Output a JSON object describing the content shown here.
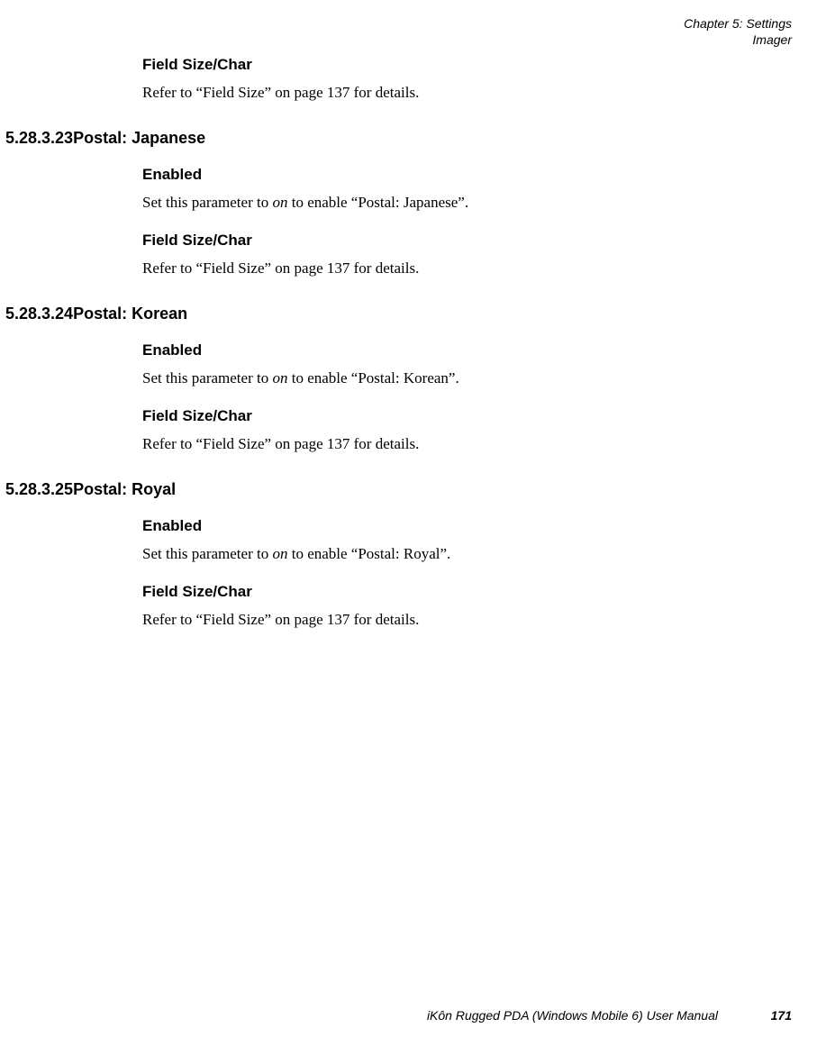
{
  "header": {
    "chapter_line": "Chapter 5:  Settings",
    "section_line": "Imager"
  },
  "block0": {
    "h1": "Field Size/Char",
    "p1a": "Refer to “Field Size” on page 137 for details."
  },
  "sec23": {
    "num": "5.28.3.23",
    "title": "Postal: Japanese",
    "h1": "Enabled",
    "p1a": "Set this parameter to ",
    "p1i": "on",
    "p1b": " to enable “Postal: Japanese”.",
    "h2": "Field Size/Char",
    "p2a": "Refer to “Field Size” on page 137 for details."
  },
  "sec24": {
    "num": "5.28.3.24",
    "title": "Postal: Korean",
    "h1": "Enabled",
    "p1a": "Set this parameter to ",
    "p1i": "on",
    "p1b": " to enable “Postal: Korean”.",
    "h2": "Field Size/Char",
    "p2a": "Refer to “Field Size” on page 137 for details."
  },
  "sec25": {
    "num": "5.28.3.25",
    "title": "Postal: Royal",
    "h1": "Enabled",
    "p1a": "Set this parameter to ",
    "p1i": "on",
    "p1b": " to enable “Postal: Royal”.",
    "h2": "Field Size/Char",
    "p2a": "Refer to “Field Size” on page 137 for details."
  },
  "footer": {
    "manual_title": "iKôn Rugged PDA (Windows Mobile 6) User Manual",
    "page_number": "171"
  }
}
